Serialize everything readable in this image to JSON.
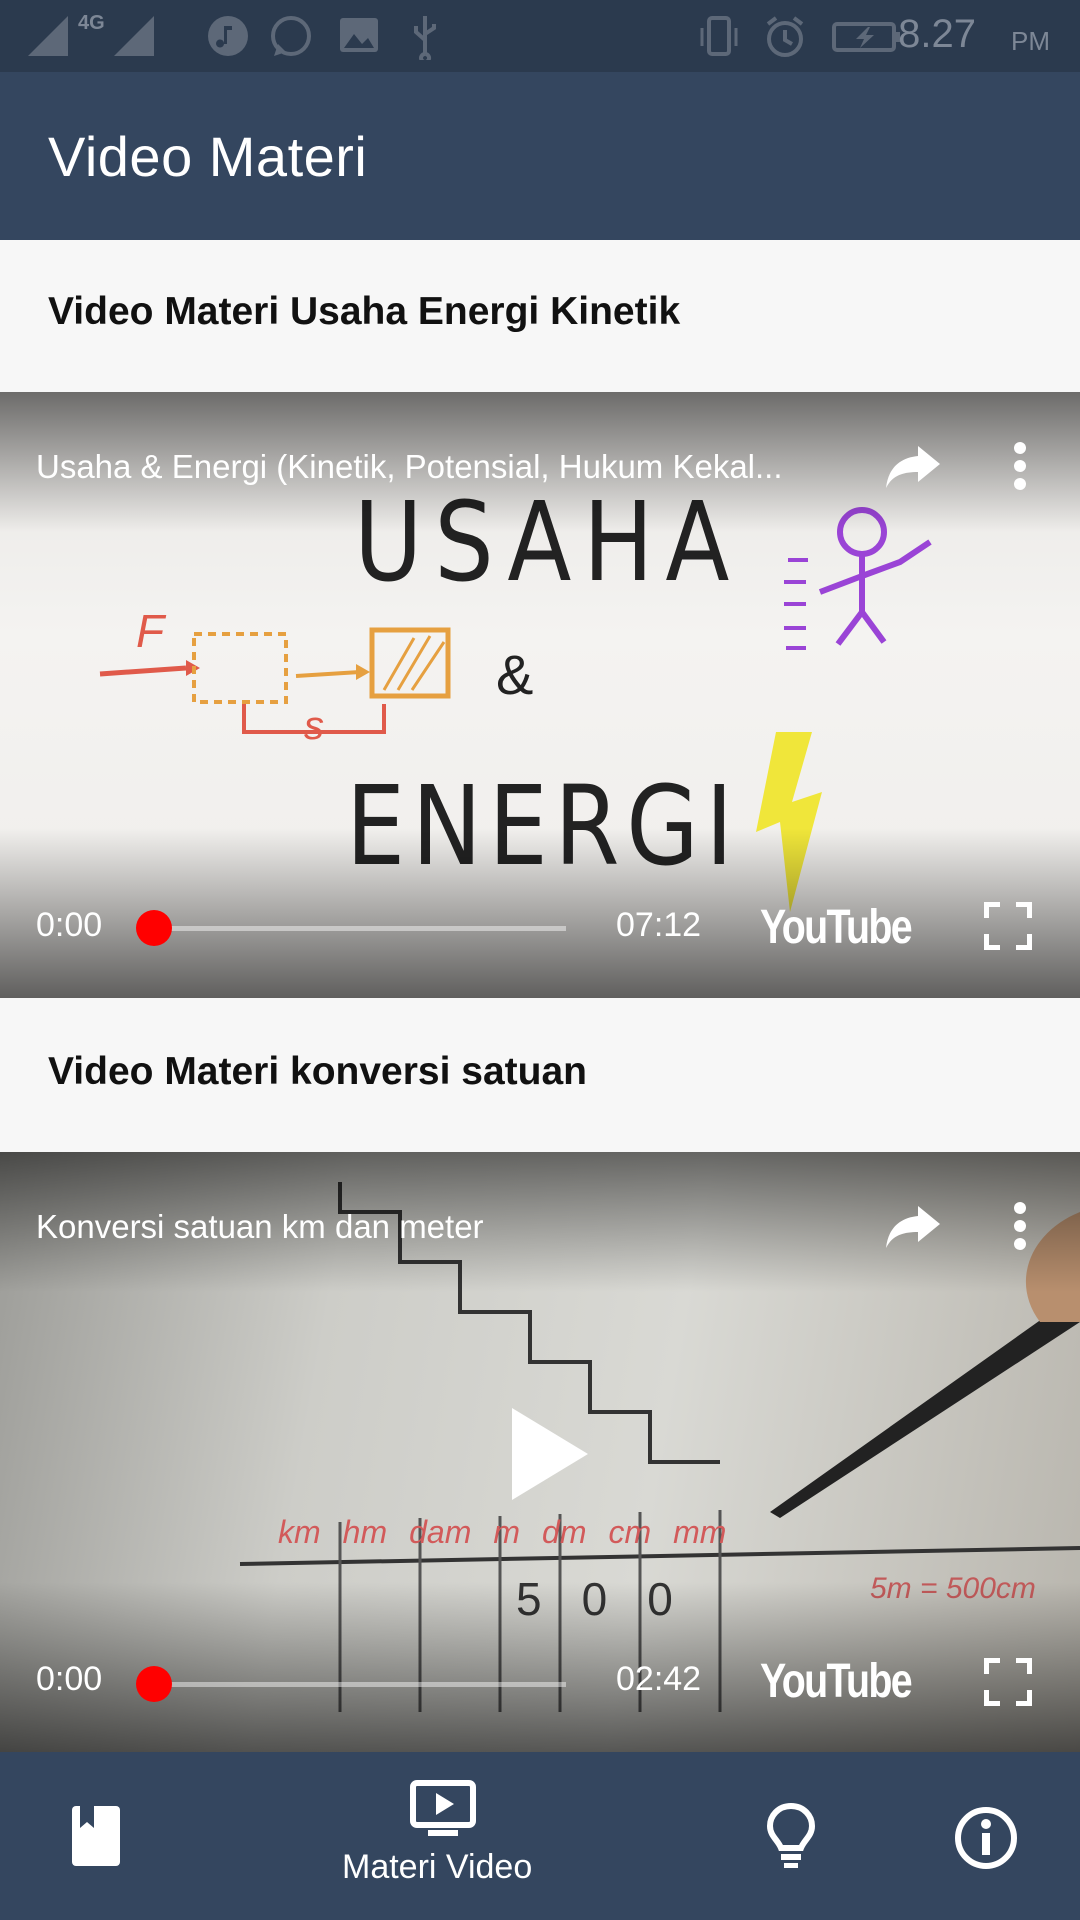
{
  "status_bar": {
    "network_label": "4G",
    "time": "8.27",
    "ampm": "PM",
    "icons": [
      "signal-sim1-icon",
      "signal-sim2-icon",
      "music-icon",
      "whatsapp-icon",
      "image-icon",
      "usb-icon",
      "vibrate-icon",
      "alarm-icon",
      "battery-charging-icon"
    ]
  },
  "app_bar": {
    "title": "Video Materi"
  },
  "sections": [
    {
      "heading": "Video Materi Usaha Energi Kinetik",
      "video": {
        "title": "Usaha & Energi (Kinetik, Potensial, Hukum Kekal...",
        "current_time": "0:00",
        "duration": "07:12",
        "progress": 0,
        "logo": "YouTube",
        "thumbnail_text_top": "USAHA",
        "thumbnail_text_mid": "&",
        "thumbnail_text_bottom": "ENERGI",
        "thumbnail_labels": [
          "F",
          "s"
        ]
      }
    },
    {
      "heading": "Video Materi konversi satuan",
      "video": {
        "title": "Konversi satuan km dan meter",
        "current_time": "0:00",
        "duration": "02:42",
        "progress": 0,
        "logo": "YouTube",
        "thumbnail_units": [
          "km",
          "hm",
          "dam",
          "m",
          "dm",
          "cm",
          "mm"
        ],
        "thumbnail_digits": [
          "5",
          "0",
          "0"
        ],
        "thumbnail_note": "5m = 500cm"
      }
    }
  ],
  "bottom_nav": {
    "items": [
      {
        "icon": "book-icon",
        "label": "",
        "active": false
      },
      {
        "icon": "video-icon",
        "label": "Materi Video",
        "active": true
      },
      {
        "icon": "lightbulb-icon",
        "label": "",
        "active": false
      },
      {
        "icon": "info-icon",
        "label": "",
        "active": false
      }
    ]
  },
  "colors": {
    "status_bar": "#2b3a4e",
    "app_bar": "#34465f",
    "progress_accent": "#ff0000",
    "background": "#f7f7f7"
  }
}
